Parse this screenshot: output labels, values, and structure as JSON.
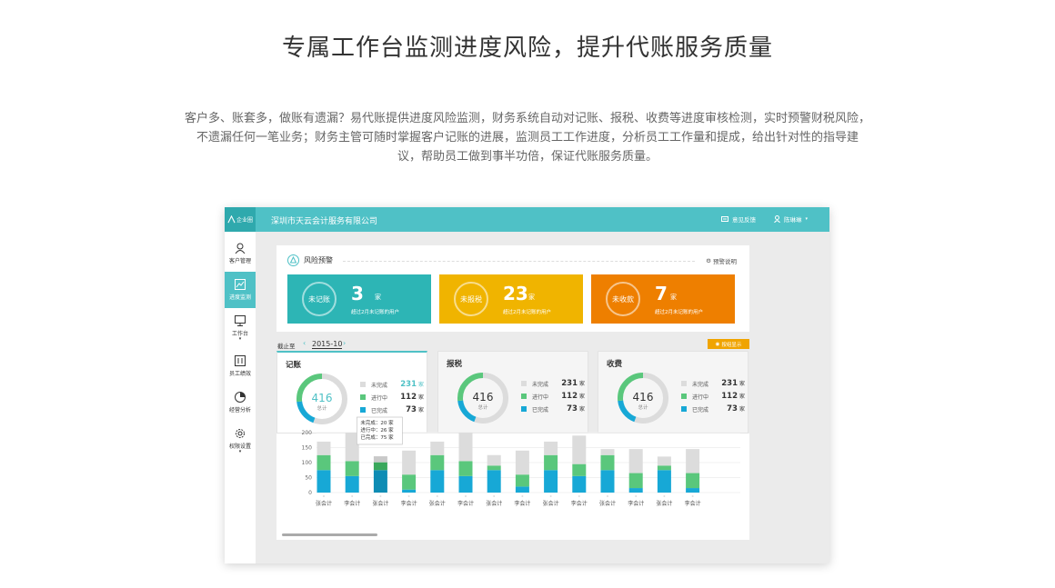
{
  "hero": {
    "title": "专属工作台监测进度风险，提升代账服务质量",
    "desc_line1": "客户多、账套多，做账有遗漏？易代账提供进度风险监测，财务系统自动对记账、报税、收费等进度审核检测，实时预警财税风险，",
    "desc_line2": "不遗漏任何一笔业务；财务主管可随时掌握客户记账的进展，监测员工工作进度，分析员工工作量和提成，给出针对性的指导建",
    "desc_line3": "议，帮助员工做到事半功倍，保证代账服务质量。"
  },
  "topbar": {
    "logo_text": "企业圈",
    "company": "深圳市天云会计服务有限公司",
    "feedback": "意见反馈",
    "username": "陈琳琳"
  },
  "sidebar": {
    "items": [
      {
        "label": "客户管理",
        "icon": "user-icon"
      },
      {
        "label": "进度监测",
        "icon": "chart-icon"
      },
      {
        "label": "工作台",
        "icon": "monitor-icon"
      },
      {
        "label": "员工绩效",
        "icon": "performance-icon"
      },
      {
        "label": "经营分析",
        "icon": "pie-icon"
      },
      {
        "label": "权限设置",
        "icon": "gear-icon"
      }
    ]
  },
  "risk": {
    "title": "风险预警",
    "explain": "预警说明",
    "cards": [
      {
        "label": "未记账",
        "count": "3",
        "unit": "家",
        "sub": "超过2月未记账的用户",
        "color": "#2db5b5"
      },
      {
        "label": "未报税",
        "count": "23",
        "unit": "家",
        "sub": "超过2月未记账的用户",
        "color": "#f0b400"
      },
      {
        "label": "未收款",
        "count": "7",
        "unit": "家",
        "sub": "超过2月未记账的用户",
        "color": "#ee7f00"
      }
    ]
  },
  "filter": {
    "label": "截止至",
    "prev": "‹",
    "date": "2015-10",
    "next": "›",
    "toggle": "按组显示"
  },
  "stats": [
    {
      "title": "记账",
      "total": "416",
      "total_label": "总计",
      "rows": [
        {
          "label": "未完成",
          "value": "231",
          "unit": "家",
          "color": "#dcdcdc",
          "valcolor": "#4fc1c6"
        },
        {
          "label": "进行中",
          "value": "112",
          "unit": "家",
          "color": "#5ac77c",
          "valcolor": "#333333"
        },
        {
          "label": "已完成",
          "value": "73",
          "unit": "家",
          "color": "#17a8d6",
          "valcolor": "#333333"
        }
      ]
    },
    {
      "title": "报税",
      "total": "416",
      "total_label": "总计",
      "rows": [
        {
          "label": "未完成",
          "value": "231",
          "unit": "家",
          "color": "#dcdcdc",
          "valcolor": "#333333"
        },
        {
          "label": "进行中",
          "value": "112",
          "unit": "家",
          "color": "#5ac77c",
          "valcolor": "#333333"
        },
        {
          "label": "已完成",
          "value": "73",
          "unit": "家",
          "color": "#17a8d6",
          "valcolor": "#333333"
        }
      ]
    },
    {
      "title": "收费",
      "total": "416",
      "total_label": "总计",
      "rows": [
        {
          "label": "未完成",
          "value": "231",
          "unit": "家",
          "color": "#dcdcdc",
          "valcolor": "#333333"
        },
        {
          "label": "进行中",
          "value": "112",
          "unit": "家",
          "color": "#5ac77c",
          "valcolor": "#333333"
        },
        {
          "label": "已完成",
          "value": "73",
          "unit": "家",
          "color": "#17a8d6",
          "valcolor": "#333333"
        }
      ]
    }
  ],
  "colors": {
    "accent": "#4fc1c6",
    "incomplete": "#dcdcdc",
    "in_progress": "#5ac77c",
    "done": "#17a8d6",
    "highlight_done": "#0e8cb4",
    "highlight_progress": "#3aa85c",
    "highlight_incomplete": "#c9c9c9"
  },
  "tooltip": {
    "lines": [
      "未完成：20 家",
      "进行中：26 家",
      "已完成：75 家"
    ]
  },
  "chart_data": {
    "type": "bar",
    "stacked": true,
    "categories": [
      "张会计",
      "李会计",
      "张会计",
      "李会计",
      "张会计",
      "李会计",
      "张会计",
      "李会计",
      "张会计",
      "李会计",
      "张会计",
      "李会计",
      "张会计",
      "李会计"
    ],
    "series": [
      {
        "name": "已完成",
        "values": [
          75,
          55,
          75,
          10,
          75,
          55,
          75,
          20,
          75,
          55,
          75,
          15,
          75,
          15
        ]
      },
      {
        "name": "进行中",
        "values": [
          50,
          50,
          26,
          50,
          50,
          50,
          15,
          40,
          50,
          40,
          50,
          50,
          15,
          50
        ]
      },
      {
        "name": "未完成",
        "values": [
          45,
          95,
          20,
          80,
          45,
          95,
          35,
          80,
          45,
          95,
          20,
          80,
          30,
          80
        ]
      }
    ],
    "highlight_index": 2,
    "yticks": [
      0,
      50,
      100,
      150,
      200
    ],
    "ylim": [
      0,
      200
    ],
    "grid": true
  }
}
